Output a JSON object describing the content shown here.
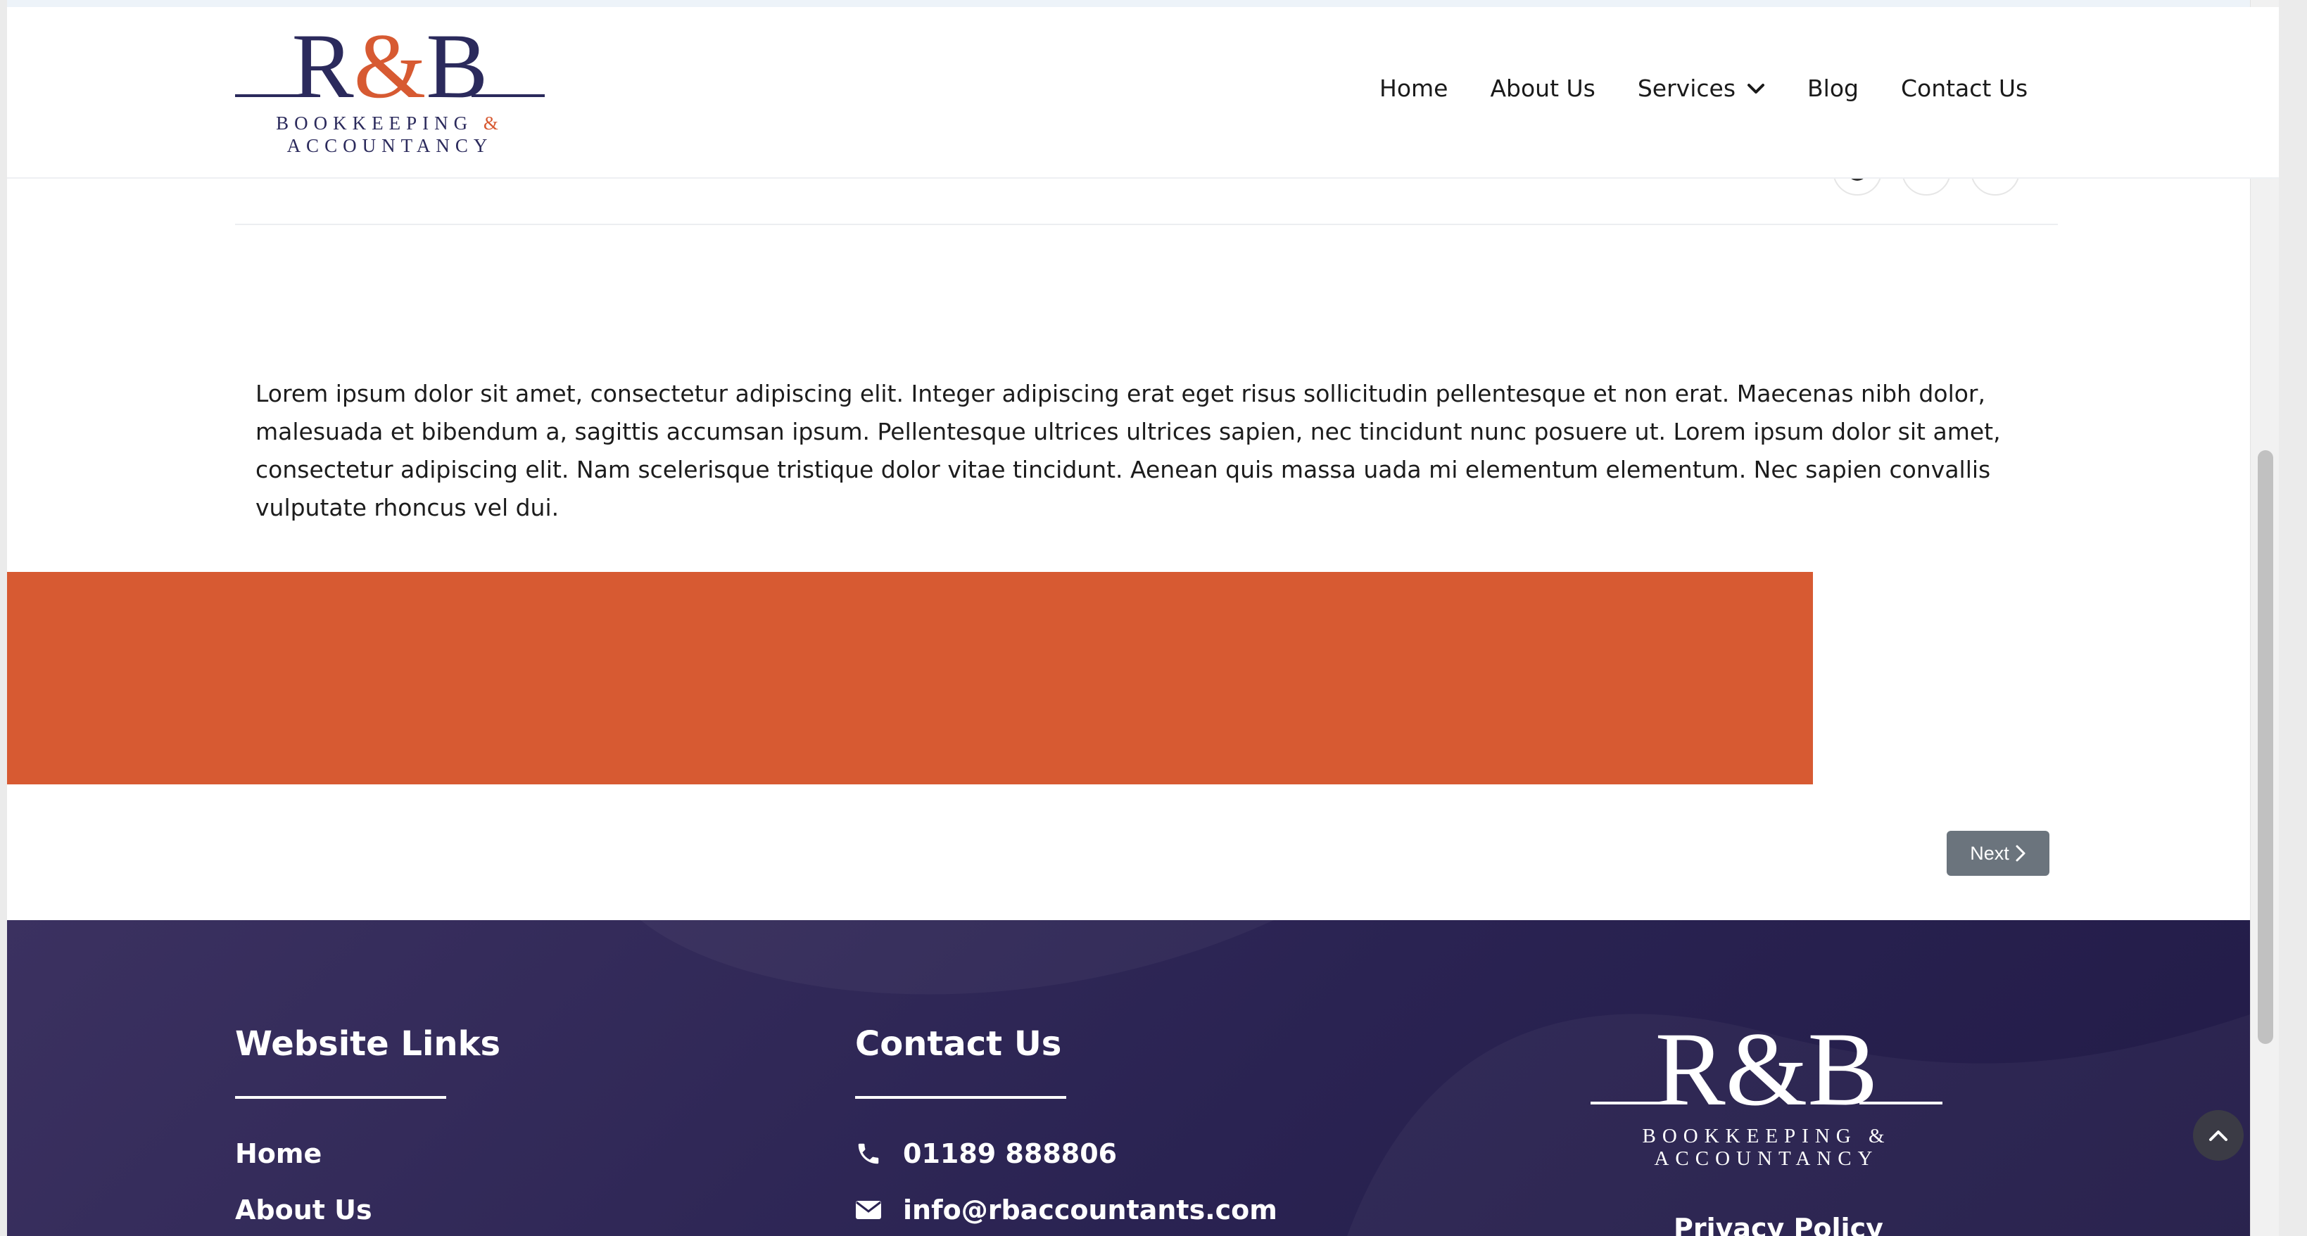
{
  "brand": {
    "logo_letters": "R&B",
    "logo_line1": "BOOKKEEPING",
    "logo_amp": "&",
    "logo_line2": "ACCOUNTANCY",
    "navy": "#2b2a5c",
    "orange": "#d75a32"
  },
  "nav": {
    "home": "Home",
    "about": "About Us",
    "services": "Services",
    "blog": "Blog",
    "contact": "Contact Us"
  },
  "social": {
    "icons": [
      "facebook-icon",
      "x-icon",
      "linkedin-icon"
    ]
  },
  "article": {
    "body": "Lorem ipsum dolor sit amet, consectetur adipiscing elit. Integer adipiscing erat eget risus sollicitudin pellentesque et non erat. Maecenas nibh dolor, malesuada et bibendum a, sagittis accumsan ipsum. Pellentesque ultrices ultrices sapien, nec tincidunt nunc posuere ut. Lorem ipsum dolor sit amet, consectetur adipiscing elit. Nam scelerisque tristique dolor vitae tincidunt. Aenean quis massa uada mi elementum elementum. Nec sapien convallis vulputate rhoncus vel dui."
  },
  "pager": {
    "next_label": "Next"
  },
  "footer": {
    "links_title": "Website Links",
    "links": [
      "Home",
      "About Us"
    ],
    "contact_title": "Contact Us",
    "phone": "01189 888806",
    "email": "info@rbaccountants.com",
    "privacy": "Privacy Policy"
  }
}
